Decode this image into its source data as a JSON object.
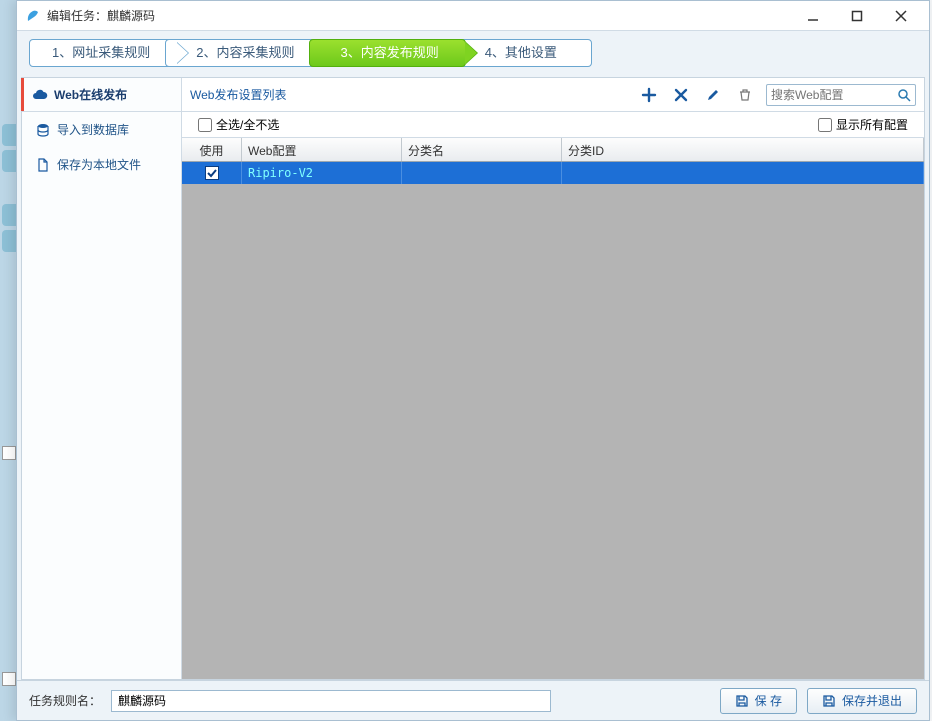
{
  "window": {
    "title_prefix": "编辑任务：",
    "title_name": "麒麟源码"
  },
  "steps": [
    {
      "label": "1、网址采集规则"
    },
    {
      "label": "2、内容采集规则"
    },
    {
      "label": "3、内容发布规则"
    },
    {
      "label": "4、其他设置"
    }
  ],
  "active_step_index": 2,
  "sidebar": {
    "heading": "Web在线发布",
    "items": [
      {
        "icon": "database-icon",
        "label": "导入到数据库"
      },
      {
        "icon": "file-icon",
        "label": "保存为本地文件"
      }
    ]
  },
  "content": {
    "list_title": "Web发布设置列表",
    "search_placeholder": "搜索Web配置",
    "select_all_label": "全选/全不选",
    "show_all_label": "显示所有配置",
    "columns": {
      "use": "使用",
      "config": "Web配置",
      "category": "分类名",
      "category_id": "分类ID"
    },
    "rows": [
      {
        "use": true,
        "config": "Ripiro-V2",
        "category": "",
        "category_id": ""
      }
    ]
  },
  "footer": {
    "label": "任务规则名：",
    "value": "麒麟源码",
    "save": "保 存",
    "save_exit": "保存并退出"
  }
}
